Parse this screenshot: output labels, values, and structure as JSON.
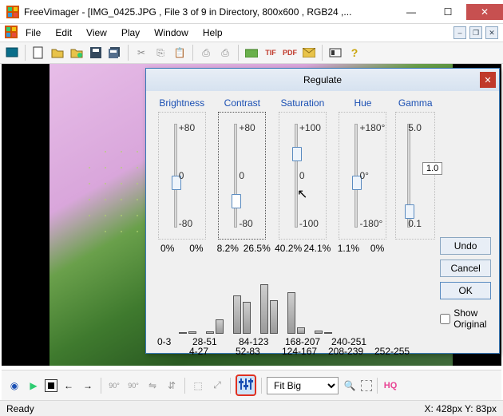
{
  "window": {
    "title": "FreeVimager - [IMG_0425.JPG , File 3 of 9 in Directory, 800x600 , RGB24 ,..."
  },
  "menu": {
    "file": "File",
    "edit": "Edit",
    "view": "View",
    "play": "Play",
    "window": "Window",
    "help": "Help"
  },
  "dialog": {
    "title": "Regulate",
    "sliders": {
      "brightness": {
        "label": "Brightness",
        "max": "+80",
        "mid": "0",
        "min": "-80",
        "pct_l": "0%",
        "pct_r": "0%",
        "thumb": 50
      },
      "contrast": {
        "label": "Contrast",
        "max": "+80",
        "mid": "0",
        "min": "-80",
        "pct_l": "8.2%",
        "pct_r": "26.5%",
        "thumb": 68
      },
      "saturation": {
        "label": "Saturation",
        "max": "+100",
        "mid": "0",
        "min": "-100",
        "pct_l": "40.2%",
        "pct_r": "24.1%",
        "thumb": 22
      },
      "hue": {
        "label": "Hue",
        "max": "+180°",
        "mid": "0°",
        "min": "-180°",
        "pct_l": "1.1%",
        "pct_r": "0%",
        "thumb": 50
      }
    },
    "gamma": {
      "label": "Gamma",
      "max": "5.0",
      "val": "1.0",
      "min": "0.1",
      "thumb": 78
    },
    "buttons": {
      "undo": "Undo",
      "cancel": "Cancel",
      "ok": "OK"
    },
    "show_original": "Show Original",
    "hist_ranges": [
      "0-3",
      "28-51",
      "84-123",
      "168-207",
      "240-251"
    ],
    "hist_ranges2": [
      "4-27",
      "52-83",
      "124-167",
      "208-239",
      "252-255"
    ]
  },
  "bottom": {
    "zoom": "Fit Big",
    "hq": "HQ"
  },
  "status": {
    "ready": "Ready",
    "coords": "X: 428px  Y: 83px"
  }
}
